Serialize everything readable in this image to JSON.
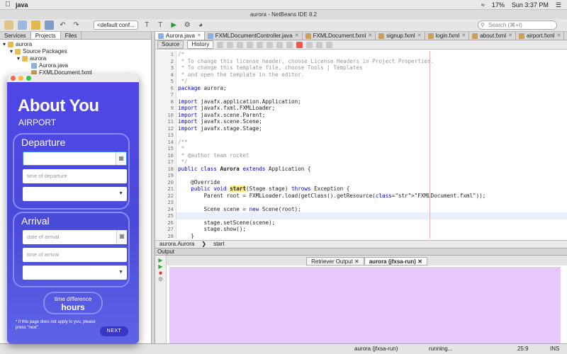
{
  "menubar": {
    "app": "java",
    "clock": "Sun 3:37 PM",
    "battery": "17%"
  },
  "window": {
    "title": "aurora - NetBeans IDE 8.2"
  },
  "toolbar": {
    "config": "<default conf...",
    "search_placeholder": "Search (⌘+I)"
  },
  "projects": {
    "tabs": [
      "Services",
      "Projects",
      "Files"
    ],
    "tree": [
      {
        "label": "aurora",
        "indent": 1,
        "icon": "project-icon"
      },
      {
        "label": "Source Packages",
        "indent": 2,
        "icon": "package-icon"
      },
      {
        "label": "aurora",
        "indent": 3,
        "icon": "package-icon"
      },
      {
        "label": "Aurora.java",
        "indent": 4,
        "icon": "java-file-icon"
      },
      {
        "label": "FXMLDocument.fxml",
        "indent": 4,
        "icon": "fxml-file-icon"
      }
    ]
  },
  "editor": {
    "tabs": [
      "Aurora.java",
      "FXMLDocumentController.java",
      "FXMLDocument.fxml",
      "signup.fxml",
      "login.fxml",
      "about.fxml",
      "airport.fxml"
    ],
    "source_label": "Source",
    "history_label": "History",
    "lines": [
      {
        "n": "1",
        "t": "/*",
        "c": "cm"
      },
      {
        "n": "2",
        "t": " * To change this license header, choose License Headers in Project Properties.",
        "c": "cm"
      },
      {
        "n": "3",
        "t": " * To change this template file, choose Tools | Templates",
        "c": "cm"
      },
      {
        "n": "4",
        "t": " * and open the template in the editor.",
        "c": "cm"
      },
      {
        "n": "5",
        "t": " */",
        "c": "cm"
      },
      {
        "n": "6",
        "t": "package aurora;",
        "c": "kwline"
      },
      {
        "n": "7",
        "t": "",
        "c": ""
      },
      {
        "n": "8",
        "t": "import javafx.application.Application;",
        "c": "imp"
      },
      {
        "n": "9",
        "t": "import javafx.fxml.FXMLLoader;",
        "c": "imp"
      },
      {
        "n": "10",
        "t": "import javafx.scene.Parent;",
        "c": "imp"
      },
      {
        "n": "11",
        "t": "import javafx.scene.Scene;",
        "c": "imp"
      },
      {
        "n": "12",
        "t": "import javafx.stage.Stage;",
        "c": "imp"
      },
      {
        "n": "13",
        "t": "",
        "c": ""
      },
      {
        "n": "14",
        "t": "/**",
        "c": "cm"
      },
      {
        "n": "15",
        "t": " *",
        "c": "cm"
      },
      {
        "n": "16",
        "t": " * @author team rocket",
        "c": "cm"
      },
      {
        "n": "17",
        "t": " */",
        "c": "cm"
      },
      {
        "n": "18",
        "t": "public class Aurora extends Application {",
        "c": "cls"
      },
      {
        "n": "19",
        "t": "",
        "c": ""
      },
      {
        "n": "20",
        "t": "    @Override",
        "c": ""
      },
      {
        "n": "21",
        "t": "    public void start(Stage stage) throws Exception {",
        "c": "meth"
      },
      {
        "n": "22",
        "t": "        Parent root = FXMLLoader.load(getClass().getResource(\"FXMLDocument.fxml\"));",
        "c": "load"
      },
      {
        "n": "23",
        "t": "",
        "c": ""
      },
      {
        "n": "24",
        "t": "        Scene scene = new Scene(root);",
        "c": "newl"
      },
      {
        "n": "25",
        "t": "",
        "c": "cur"
      },
      {
        "n": "26",
        "t": "        stage.setScene(scene);",
        "c": ""
      },
      {
        "n": "27",
        "t": "        stage.show();",
        "c": ""
      },
      {
        "n": "28",
        "t": "    }",
        "c": ""
      }
    ],
    "breadcrumb": [
      "aurora.Aurora",
      "start"
    ]
  },
  "output": {
    "title": "Output",
    "tabs": [
      "Retriever Output",
      "aurora (jfxsa-run)"
    ]
  },
  "status": {
    "process": "aurora (jfxsa-run)",
    "state": "running...",
    "position": "25:9",
    "mode": "INS"
  },
  "fxapp": {
    "title": "About You",
    "subtitle": "AIRPORT",
    "departure_heading": "Departure",
    "departure_time_placeholder": "time of departure",
    "arrival_heading": "Arrival",
    "arrival_date_placeholder": "date of arrival",
    "arrival_time_placeholder": "time of arrival",
    "pill_line1": "time difference",
    "pill_line2": "hours",
    "note": "* if this page does not apply to you, please press \"next\".",
    "next_label": "NEXT"
  },
  "colors": {
    "fx_bg": "#5046e8",
    "output_bg": "#e6c8ff",
    "keyword": "#0000e6"
  }
}
